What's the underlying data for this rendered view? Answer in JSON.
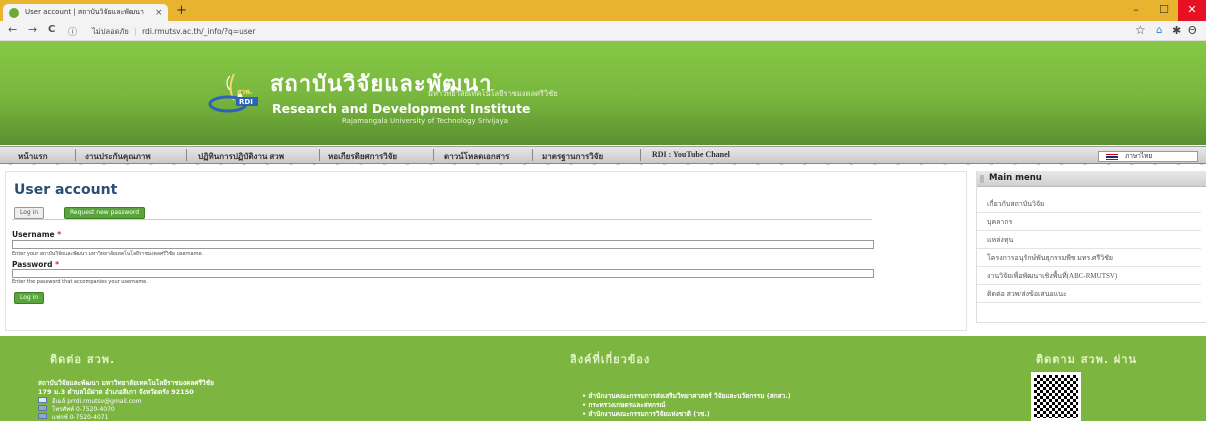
{
  "browser": {
    "tab_title": "User account | สถาบันวิจัยและพัฒนา",
    "url_security": "ไม่ปลอดภัย",
    "url": "rdi.rmutsv.ac.th/_info/?q=user",
    "icons": {
      "back": "←",
      "forward": "→",
      "reload": "C",
      "info": "ⓘ",
      "star": "☆",
      "new_tab": "+",
      "close": "×",
      "minimize": "–",
      "maximize": "☐",
      "close_window": "✕",
      "account": "Θ",
      "extensions": "✱",
      "ext2": "⌂"
    }
  },
  "header": {
    "thai_title": "สถาบันวิจัยและพัฒนา",
    "thai_subtitle": "มหาวิทยาลัยเทคโนโลยีราชมงคลศรีวิชัย",
    "en_title": "Research and Development Institute",
    "en_subtitle": "Rajamangala University of Technology Srivijaya",
    "logo_text": "สวพ. RDI"
  },
  "nav": {
    "items": [
      "หน้าแรก",
      "งานประกันคุณภาพ",
      "ปฏิทินการปฏิบัติงาน สวพ",
      "หอเกียรติยศการวิจัย",
      "ดาวน์โหลดเอกสาร",
      "มาตรฐานการวิจัย",
      "RDI : YouTube Chanel"
    ],
    "language": "ภาษาไทย"
  },
  "main": {
    "title": "User account",
    "tabs": [
      "Log in",
      "Request new password"
    ],
    "username_label": "Username",
    "username_value": "",
    "username_desc": "Enter your สถาบันวิจัยและพัฒนา มหาวิทยาลัยเทคโนโลยีราชมงคลศรีวิชัย username.",
    "password_label": "Password",
    "password_value": "",
    "password_desc": "Enter the password that accompanies your username.",
    "required_marker": "*",
    "login_button": "Log in"
  },
  "sidebar": {
    "heading": "Main menu",
    "items": [
      "เกี่ยวกับสถาบันวิจัย",
      "บุคลากร",
      "แหล่งทุน",
      "โครงการอนุรักษ์พันธุกรรมพืช มทร.ศรีวิชัย",
      "งานวิจัยเพื่อพัฒนาเชิงพื้นที่(ABC-RMUTSV)",
      "ติดต่อ สวพ/ส่งข้อเสนอแนะ"
    ]
  },
  "footer": {
    "contact_heading": "ติดต่อ สวพ.",
    "org_name": "สถาบันวิจัยและพัฒนา มหาวิทยาลัยเทคโนโลยีราชมงคลศรีวิชัย",
    "address": "179 ม.3 ตำบลไม้ฝาด อำเภอสิเกา จังหวัดตรัง 92150",
    "email": "อีเมล์ prrdi.rmutsv@gmail.com",
    "phone": "โทรศัพท์ 0-7520-4070",
    "fax": "แฟกซ์ 0-7520-4071",
    "links_heading": "ลิงค์ที่เกี่ยวข้อง",
    "links": [
      "สำนักงานคณะกรรมการส่งเสริมวิทยาศาสตร์ วิจัยและนวัตกรรม (สกสว.)",
      "กระทรวงเกษตรและสหกรณ์",
      "สำนักงานคณะกรรมการวิจัยแห่งชาติ (วช.)"
    ],
    "follow_heading": "ติดตาม สวพ. ผ่าน"
  }
}
